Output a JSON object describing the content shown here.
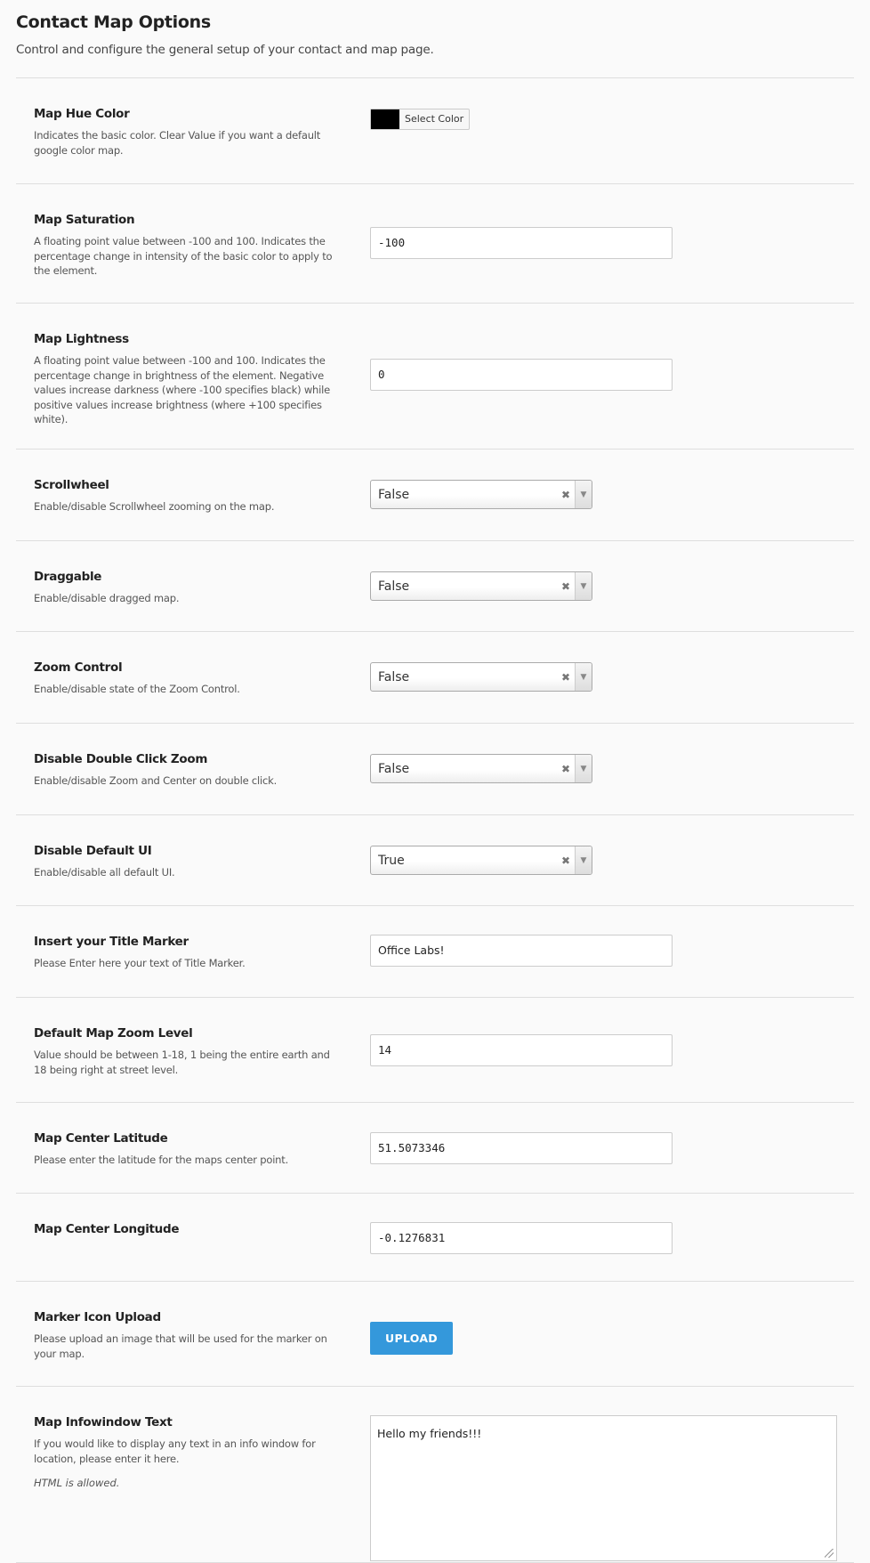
{
  "header": {
    "title": "Contact Map Options",
    "subtitle": "Control and configure the general setup of your contact and map page."
  },
  "fields": {
    "hue": {
      "label": "Map Hue Color",
      "desc": "Indicates the basic color. Clear Value if you want a default google color map.",
      "button": "Select Color",
      "color": "#000000"
    },
    "saturation": {
      "label": "Map Saturation",
      "desc": "A floating point value between -100 and 100. Indicates the percentage change in intensity of the basic color to apply to the element.",
      "value": "-100"
    },
    "lightness": {
      "label": "Map Lightness",
      "desc": "A floating point value between -100 and 100. Indicates the percentage change in brightness of the element. Negative values increase darkness (where -100 specifies black) while positive values increase brightness (where +100 specifies white).",
      "value": "0"
    },
    "scrollwheel": {
      "label": "Scrollwheel",
      "desc": "Enable/disable Scrollwheel zooming on the map.",
      "value": "False"
    },
    "draggable": {
      "label": "Draggable",
      "desc": "Enable/disable dragged map.",
      "value": "False"
    },
    "zoom_control": {
      "label": "Zoom Control",
      "desc": "Enable/disable state of the Zoom Control.",
      "value": "False"
    },
    "dbl_click": {
      "label": "Disable Double Click Zoom",
      "desc": "Enable/disable Zoom and Center on double click.",
      "value": "False"
    },
    "default_ui": {
      "label": "Disable Default UI",
      "desc": "Enable/disable all default UI.",
      "value": "True"
    },
    "title_marker": {
      "label": "Insert your Title Marker",
      "desc": "Please Enter here your text of Title Marker.",
      "value": "Office Labs!"
    },
    "zoom_level": {
      "label": "Default Map Zoom Level",
      "desc": "Value should be between 1-18, 1 being the entire earth and 18 being right at street level.",
      "value": "14"
    },
    "latitude": {
      "label": "Map Center Latitude",
      "desc": "Please enter the latitude for the maps center point.",
      "value": "51.5073346"
    },
    "longitude": {
      "label": "Map Center Longitude",
      "value": "-0.1276831"
    },
    "marker_icon": {
      "label": "Marker Icon Upload",
      "desc": "Please upload an image that will be used for the marker on your map.",
      "button": "UPLOAD"
    },
    "infowindow": {
      "label": "Map Infowindow Text",
      "desc": "If you would like to display any text in an info window for location, please enter it here.",
      "note": "HTML is allowed.",
      "value": "Hello my friends!!!"
    }
  },
  "clear_symbol": "✖",
  "arrow_symbol": "▼"
}
